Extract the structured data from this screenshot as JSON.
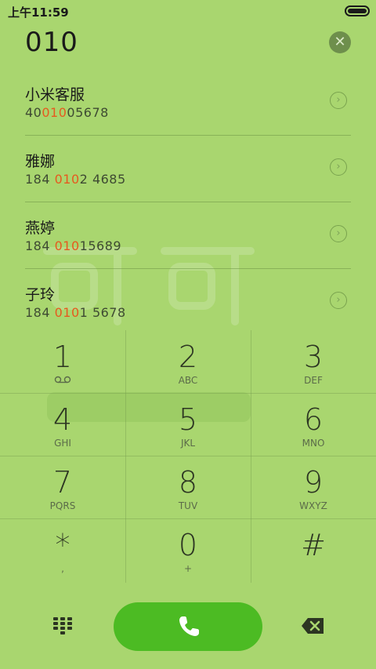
{
  "status_bar": {
    "time": "上午11:59"
  },
  "dialer": {
    "input_number": "010",
    "clear_icon": "close-icon"
  },
  "results": [
    {
      "name": "小米客服",
      "number_prefix": "40",
      "number_match": "010",
      "number_suffix": "05678"
    },
    {
      "name": "雅娜",
      "number_prefix": "184 ",
      "number_match": "010",
      "number_suffix": "2 4685"
    },
    {
      "name": "燕婷",
      "number_prefix": "184 ",
      "number_match": "010",
      "number_suffix": "15689"
    },
    {
      "name": "子玲",
      "number_prefix": "184 ",
      "number_match": "010",
      "number_suffix": "1 5678"
    }
  ],
  "keypad": {
    "keys": [
      {
        "digit": "1",
        "sub": ""
      },
      {
        "digit": "2",
        "sub": "ABC"
      },
      {
        "digit": "3",
        "sub": "DEF"
      },
      {
        "digit": "4",
        "sub": "GHI"
      },
      {
        "digit": "5",
        "sub": "JKL"
      },
      {
        "digit": "6",
        "sub": "MNO"
      },
      {
        "digit": "7",
        "sub": "PQRS"
      },
      {
        "digit": "8",
        "sub": "TUV"
      },
      {
        "digit": "9",
        "sub": "WXYZ"
      },
      {
        "digit": "*",
        "sub": ","
      },
      {
        "digit": "0",
        "sub": "+"
      },
      {
        "digit": "#",
        "sub": ""
      }
    ]
  },
  "bottom_bar": {
    "left_icon": "dialpad-icon",
    "call_icon": "phone-icon",
    "right_icon": "backspace-icon"
  },
  "colors": {
    "background": "#a9d66f",
    "accent_call": "#4cbb23",
    "match_highlight": "#e65a1f"
  }
}
